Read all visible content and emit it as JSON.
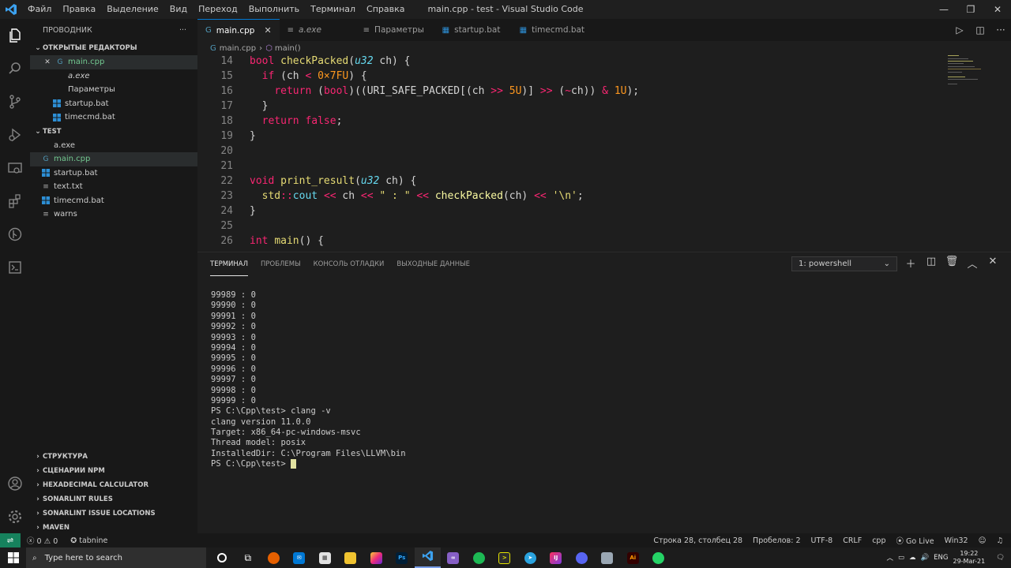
{
  "titlebar": {
    "menu": [
      "Файл",
      "Правка",
      "Выделение",
      "Вид",
      "Переход",
      "Выполнить",
      "Терминал",
      "Справка"
    ],
    "title": "main.cpp - test - Visual Studio Code"
  },
  "sidebar": {
    "title": "ПРОВОДНИК",
    "more": "···",
    "open_editors": {
      "label": "ОТКРЫТЫЕ РЕДАКТОРЫ",
      "items": [
        {
          "name": "main.cpp",
          "icon": "cpp-icon"
        },
        {
          "name": "a.exe",
          "icon": "file-icon"
        },
        {
          "name": "Параметры",
          "icon": "settings-icon"
        },
        {
          "name": "startup.bat",
          "icon": "windows-icon"
        },
        {
          "name": "timecmd.bat",
          "icon": "windows-icon"
        }
      ]
    },
    "folder": {
      "label": "TEST",
      "items": [
        {
          "name": "a.exe",
          "icon": "file-icon"
        },
        {
          "name": "main.cpp",
          "icon": "cpp-icon"
        },
        {
          "name": "startup.bat",
          "icon": "windows-icon"
        },
        {
          "name": "text.txt",
          "icon": "text-icon"
        },
        {
          "name": "timecmd.bat",
          "icon": "windows-icon"
        },
        {
          "name": "warns",
          "icon": "text-icon"
        }
      ]
    },
    "bottom_sections": [
      "СТРУКТУРА",
      "СЦЕНАРИИ NPM",
      "HEXADECIMAL CALCULATOR",
      "SONARLINT RULES",
      "SONARLINT ISSUE LOCATIONS",
      "MAVEN"
    ]
  },
  "tabs": [
    {
      "label": "main.cpp",
      "close": "✕"
    },
    {
      "label": "a.exe"
    },
    {
      "label": "Параметры"
    },
    {
      "label": "startup.bat"
    },
    {
      "label": "timecmd.bat"
    }
  ],
  "breadcrumb": {
    "file": "main.cpp",
    "symbol": "main()"
  },
  "editor": {
    "line_numbers": [
      "14",
      "15",
      "16",
      "17",
      "18",
      "19",
      "20",
      "21",
      "22",
      "23",
      "24",
      "25",
      "26"
    ]
  },
  "panel": {
    "tabs": [
      "ТЕРМИНАЛ",
      "ПРОБЛЕМЫ",
      "КОНСОЛЬ ОТЛАДКИ",
      "ВЫХОДНЫЕ ДАННЫЕ"
    ],
    "shell_select": "1: powershell",
    "terminal_lines": [
      "99989 : 0",
      "99990 : 0",
      "99991 : 0",
      "99992 : 0",
      "99993 : 0",
      "99994 : 0",
      "99995 : 0",
      "99996 : 0",
      "99997 : 0",
      "99998 : 0",
      "99999 : 0"
    ],
    "prompt1": "PS C:\\Cpp\\test> ",
    "cmd1": "clang -v",
    "output": [
      "clang version 11.0.0",
      "Target: x86_64-pc-windows-msvc",
      "Thread model: posix",
      "InstalledDir: C:\\Program Files\\LLVM\\bin"
    ],
    "prompt2": "PS C:\\Cpp\\test> "
  },
  "status": {
    "errors": "0",
    "warnings": "0",
    "tabnine": "tabnine",
    "position": "Строка 28, столбец 28",
    "spaces": "Пробелов: 2",
    "encoding": "UTF-8",
    "eol": "CRLF",
    "language": "cpp",
    "golive": "Go Live",
    "platform": "Win32"
  },
  "taskbar": {
    "search_placeholder": "Type here to search",
    "lang": "ENG",
    "time": "19:22",
    "date": "29-Mar-21"
  },
  "colors": {
    "accent": "#0078d4",
    "remote": "#16825d"
  }
}
